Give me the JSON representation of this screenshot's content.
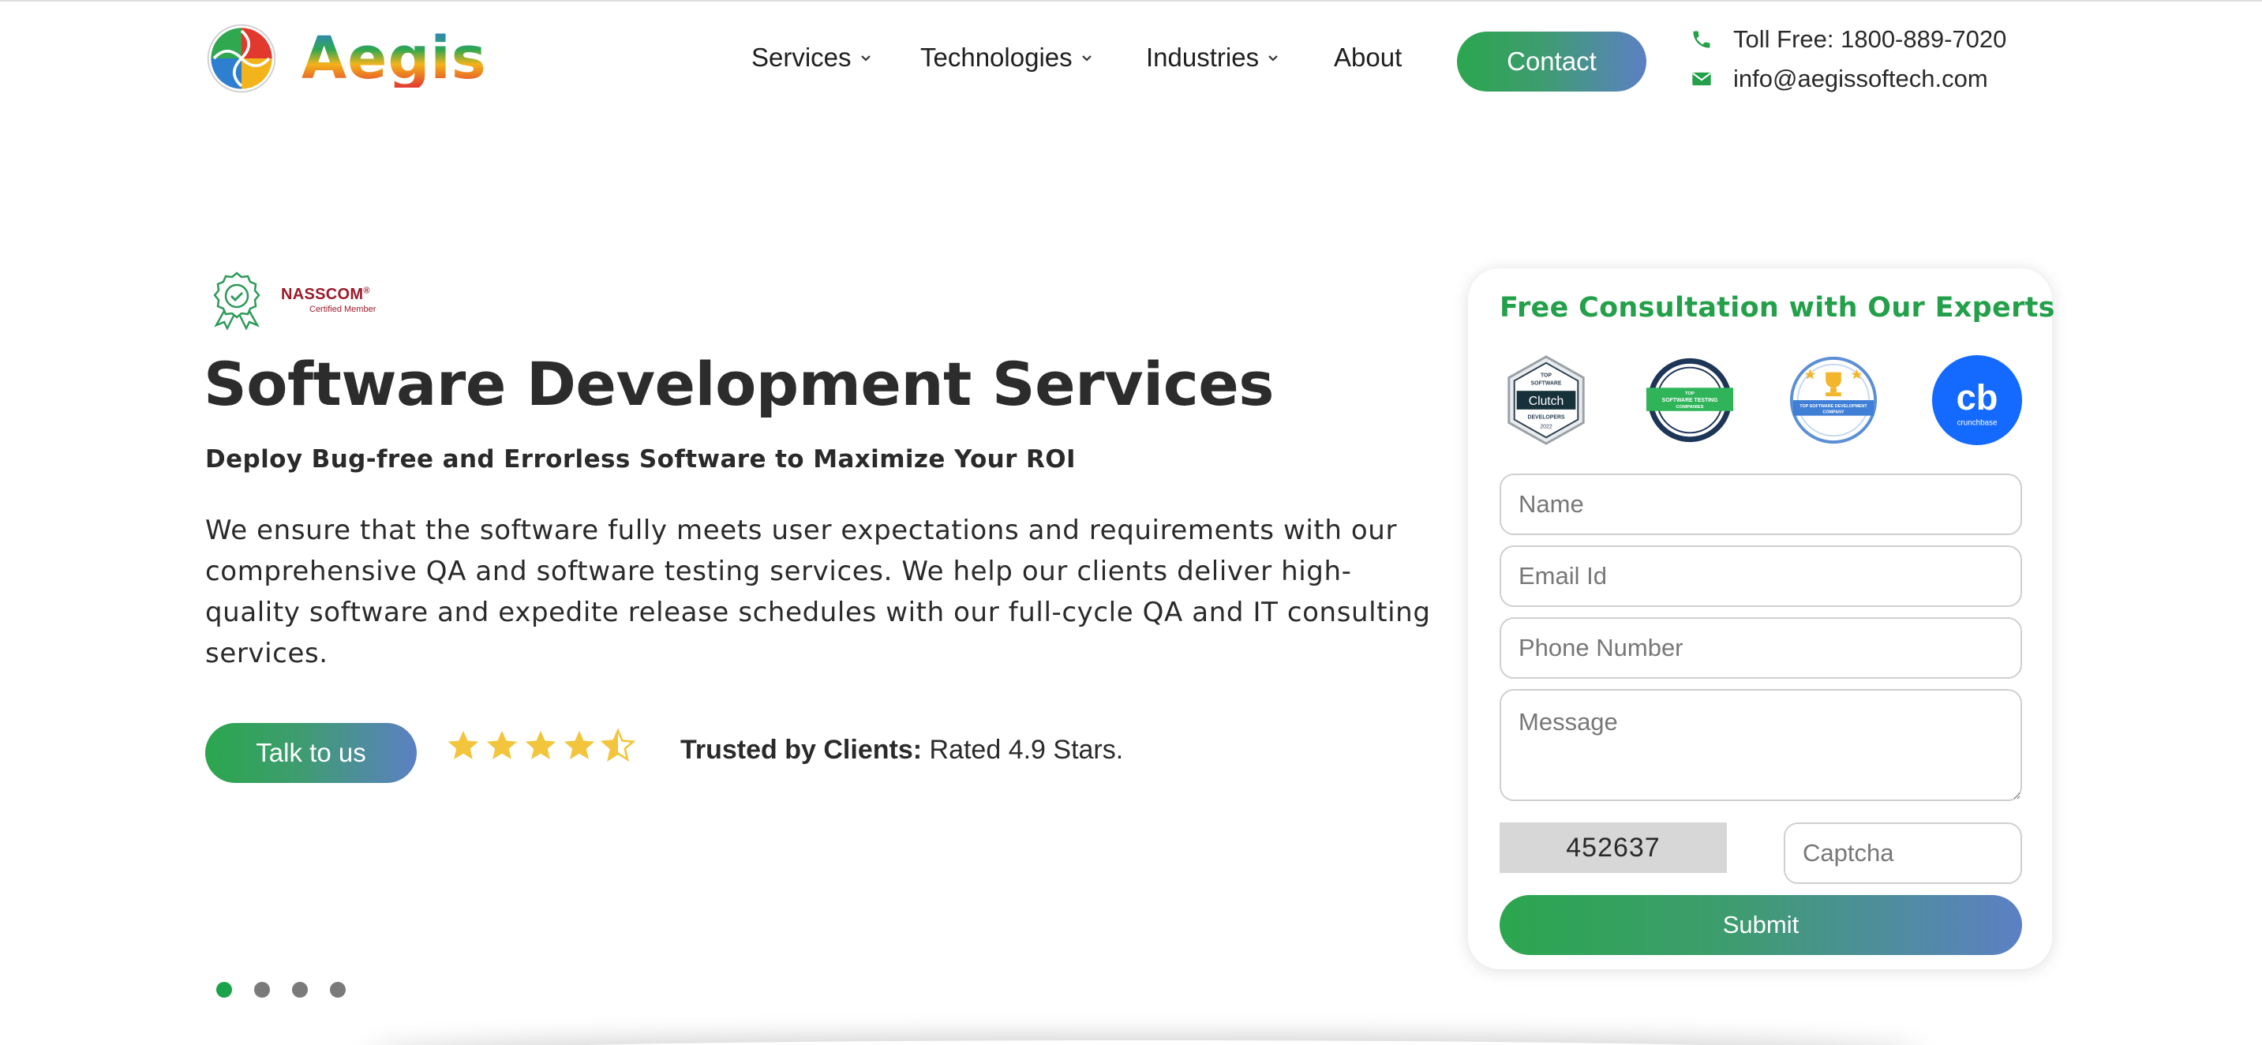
{
  "brand": {
    "name": "Aegis"
  },
  "nav": {
    "items": [
      {
        "label": "Services",
        "has_dropdown": true,
        "icon": "chevron-down-icon"
      },
      {
        "label": "Technologies",
        "has_dropdown": true,
        "icon": "chevron-down-icon"
      },
      {
        "label": "Industries",
        "has_dropdown": true,
        "icon": "chevron-down-icon"
      },
      {
        "label": "About",
        "has_dropdown": false
      }
    ],
    "contact_label": "Contact"
  },
  "contact_info": {
    "phone": "Toll Free: 1800-889-7020",
    "phone_icon": "phone-icon",
    "email": "info@aegissoftech.com",
    "email_icon": "envelope-icon"
  },
  "hero": {
    "badge": {
      "title": "NASSCOM",
      "registered": "®",
      "subtitle": "Certified Member",
      "icon": "award-ribbon-icon"
    },
    "title": "Software Development Services",
    "subtitle": "Deploy Bug-free and Errorless Software to Maximize Your ROI",
    "description": "We ensure that the software fully meets user expectations and requirements with our comprehensive QA and software testing services. We help our clients deliver high-quality software and expedite release schedules with our full-cycle QA and IT consulting services.",
    "cta_label": "Talk to us",
    "rating": {
      "stars": 4.5,
      "max": 5,
      "trusted_label": "Trusted by Clients:",
      "rating_text": "Rated 4.9 Stars."
    }
  },
  "slider": {
    "count": 4,
    "active_index": 0
  },
  "form": {
    "title": "Free Consultation with Our Experts",
    "badges": [
      {
        "icon": "clutch-badge",
        "lines": [
          "TOP",
          "SOFTWARE",
          "Clutch",
          "DEVELOPERS",
          "2022"
        ]
      },
      {
        "icon": "top-software-testing-companies-badge",
        "lines": [
          "TOP",
          "SOFTWARE TESTING",
          "COMPANIES"
        ]
      },
      {
        "icon": "top-software-development-company-badge",
        "lines": [
          "TOP SOFTWARE DEVELOPMENT",
          "COMPANY"
        ]
      },
      {
        "icon": "crunchbase-badge",
        "lines": [
          "cb",
          "crunchbase"
        ]
      }
    ],
    "fields": {
      "name_placeholder": "Name",
      "email_placeholder": "Email Id",
      "phone_placeholder": "Phone Number",
      "message_placeholder": "Message",
      "captcha_placeholder": "Captcha"
    },
    "captcha_code": "452637",
    "submit_label": "Submit"
  },
  "colors": {
    "brand_green": "#23a049",
    "gradient_start": "#2ba64e",
    "gradient_end": "#5c80c4",
    "nasscom_red": "#9b1b2a",
    "star_gold": "#f2c53d",
    "dot_active": "#1aa34a",
    "dot_inactive": "#7a7a7a"
  }
}
